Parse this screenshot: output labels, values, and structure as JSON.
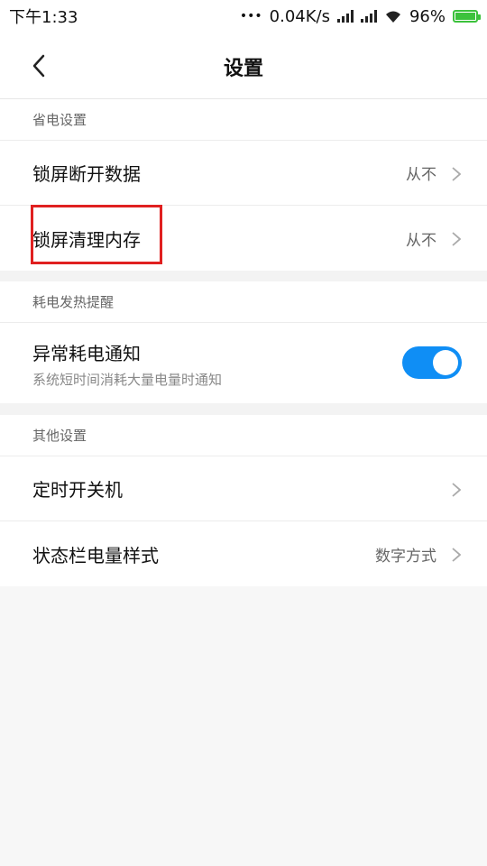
{
  "status_bar": {
    "time": "下午1:33",
    "dots": "•••",
    "speed": "0.04K/s",
    "battery_percent": "96%"
  },
  "header": {
    "title": "设置",
    "back_icon": "chevron-left-icon"
  },
  "sections": {
    "power_saving": {
      "header": "省电设置",
      "items": [
        {
          "label": "锁屏断开数据",
          "value": "从不"
        },
        {
          "label": "锁屏清理内存",
          "value": "从不"
        }
      ]
    },
    "heat": {
      "header": "耗电发热提醒",
      "items": [
        {
          "label": "异常耗电通知",
          "sub": "系统短时间消耗大量电量时通知",
          "toggle_on": true
        }
      ]
    },
    "other": {
      "header": "其他设置",
      "items": [
        {
          "label": "定时开关机",
          "value": ""
        },
        {
          "label": "状态栏电量样式",
          "value": "数字方式"
        }
      ]
    }
  },
  "colors": {
    "accent": "#0f8ef5",
    "highlight": "#e02020",
    "battery": "#3cc23c"
  }
}
